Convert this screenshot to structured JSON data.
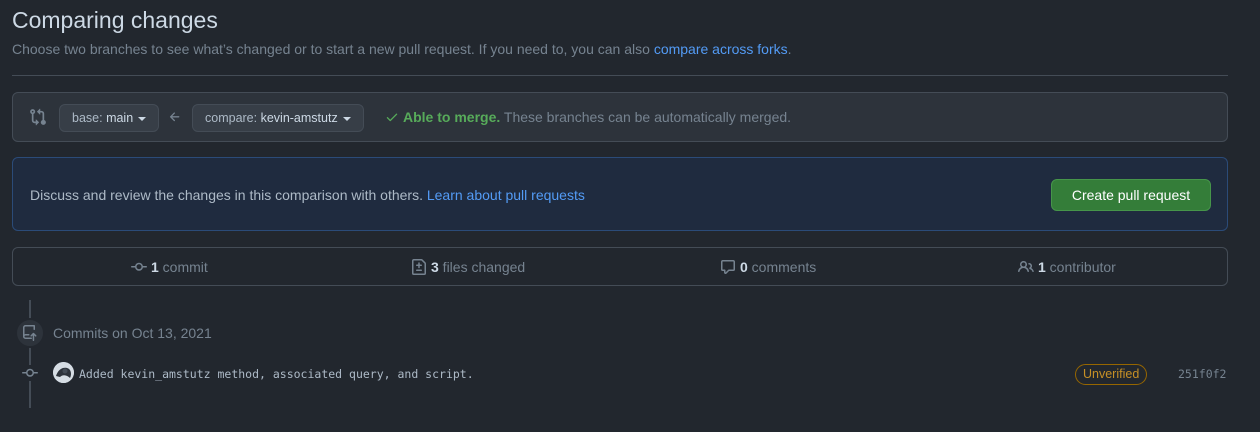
{
  "header": {
    "title": "Comparing changes",
    "subtitle_prefix": "Choose two branches to see what’s changed or to start a new pull request. If you need to, you can also ",
    "subtitle_link": "compare across forks",
    "subtitle_suffix": "."
  },
  "range": {
    "base_label": "base: ",
    "base_value": "main",
    "compare_label": "compare: ",
    "compare_value": "kevin-amstutz",
    "merge_ok": "Able to merge.",
    "merge_text": " These branches can be automatically merged."
  },
  "discuss": {
    "text": "Discuss and review the changes in this comparison with others. ",
    "link": "Learn about pull requests",
    "button": "Create pull request"
  },
  "summary": {
    "commits_count": "1",
    "commits_label": " commit",
    "files_count": "3",
    "files_label": " files changed",
    "comments_count": "0",
    "comments_label": " comments",
    "contributors_count": "1",
    "contributors_label": " contributor"
  },
  "timeline": {
    "date_heading": "Commits on Oct 13, 2021",
    "commit_message": "Added kevin_amstutz method, associated query, and script.",
    "badge": "Unverified",
    "sha": "251f0f2"
  },
  "colors": {
    "background": "#22272e",
    "link": "#539bf5",
    "success": "#57ab5a",
    "primary_button": "#347d39",
    "warning": "#c69026"
  },
  "icons": [
    "git-compare-icon",
    "arrow-left-icon",
    "check-icon",
    "git-commit-icon",
    "file-diff-icon",
    "comment-icon",
    "people-icon",
    "repo-push-icon"
  ]
}
